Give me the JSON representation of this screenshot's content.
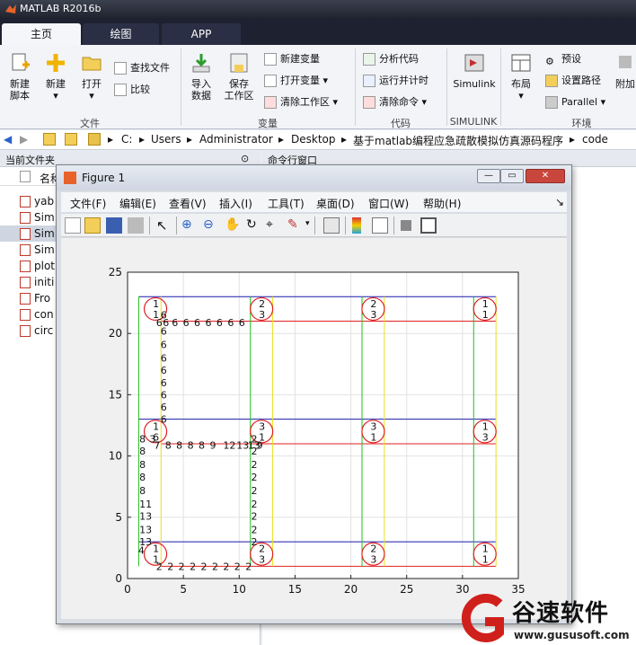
{
  "app": {
    "title": "MATLAB R2016b"
  },
  "tabs": [
    {
      "label": "主页",
      "active": true
    },
    {
      "label": "绘图",
      "active": false
    },
    {
      "label": "APP",
      "active": false
    }
  ],
  "ribbon": {
    "new_script": "新建\n脚本",
    "new": "新建",
    "open": "打开",
    "find_files": "查找文件",
    "compare": "比较",
    "import_data": "导入\n数据",
    "save_workspace": "保存\n工作区",
    "new_variable": "新建变量",
    "open_variable": "打开变量",
    "clear_workspace": "清除工作区",
    "analyze_code": "分析代码",
    "run_time": "运行并计时",
    "clear_commands": "清除命令",
    "simulink": "Simulink",
    "layout": "布局",
    "preferences": "预设",
    "set_path": "设置路径",
    "parallel": "Parallel",
    "addons": "附加",
    "groups": {
      "file": "文件",
      "variable": "变量",
      "code": "代码",
      "simulink": "SIMULINK",
      "env": "环境"
    }
  },
  "address": {
    "crumbs": [
      "C:",
      "Users",
      "Administrator",
      "Desktop",
      "基于matlab编程应急疏散模拟仿真源码程序",
      "code"
    ]
  },
  "current_folder": {
    "title": "当前文件夹",
    "name_col": "名称",
    "files": [
      "yab",
      "Sim",
      "Sim",
      "Sim",
      "plot",
      "initi",
      "Fro",
      "con",
      "circ"
    ]
  },
  "command_window": {
    "title": "命令行窗口"
  },
  "figure": {
    "title": "Figure 1",
    "menu": [
      "文件(F)",
      "编辑(E)",
      "查看(V)",
      "插入(I)",
      "工具(T)",
      "桌面(D)",
      "窗口(W)",
      "帮助(H)"
    ]
  },
  "chart_data": {
    "type": "scatter",
    "xlim": [
      0,
      35
    ],
    "ylim": [
      0,
      25
    ],
    "xticks": [
      0,
      5,
      10,
      15,
      20,
      25,
      30,
      35
    ],
    "yticks": [
      0,
      5,
      10,
      15,
      20,
      25
    ],
    "grid": true,
    "hlines": [
      {
        "y": 23,
        "x1": 1,
        "x2": 33,
        "color": "#1a1aaa"
      },
      {
        "y": 21,
        "x1": 3,
        "x2": 33,
        "color": "#e02020"
      },
      {
        "y": 13,
        "x1": 1,
        "x2": 33,
        "color": "#1a1aaa"
      },
      {
        "y": 11,
        "x1": 3,
        "x2": 33,
        "color": "#e02020"
      },
      {
        "y": 3,
        "x1": 1,
        "x2": 33,
        "color": "#1a1aaa"
      },
      {
        "y": 1,
        "x1": 3,
        "x2": 33,
        "color": "#e02020"
      }
    ],
    "vlines": [
      {
        "x": 1,
        "y1": 1,
        "y2": 23,
        "color": "#20c020"
      },
      {
        "x": 3,
        "y1": 1,
        "y2": 23,
        "color": "#e8e020"
      },
      {
        "x": 11,
        "y1": 1,
        "y2": 23,
        "color": "#20c020"
      },
      {
        "x": 13,
        "y1": 1,
        "y2": 23,
        "color": "#e8e020"
      },
      {
        "x": 21,
        "y1": 1,
        "y2": 23,
        "color": "#20c020"
      },
      {
        "x": 23,
        "y1": 1,
        "y2": 23,
        "color": "#e8e020"
      },
      {
        "x": 31,
        "y1": 1,
        "y2": 23,
        "color": "#20c020"
      },
      {
        "x": 33,
        "y1": 1,
        "y2": 23,
        "color": "#e8e020"
      }
    ],
    "circles": [
      {
        "x": 2.5,
        "y": 22,
        "top": "1",
        "bottom": "1"
      },
      {
        "x": 12,
        "y": 22,
        "top": "2",
        "bottom": "3"
      },
      {
        "x": 22,
        "y": 22,
        "top": "2",
        "bottom": "3"
      },
      {
        "x": 32,
        "y": 22,
        "top": "1",
        "bottom": "1"
      },
      {
        "x": 2.5,
        "y": 12,
        "top": "1",
        "bottom": "6"
      },
      {
        "x": 12,
        "y": 12,
        "top": "3",
        "bottom": "1"
      },
      {
        "x": 22,
        "y": 12,
        "top": "3",
        "bottom": "1"
      },
      {
        "x": 32,
        "y": 12,
        "top": "1",
        "bottom": "3"
      },
      {
        "x": 2.5,
        "y": 2,
        "top": "1",
        "bottom": "1"
      },
      {
        "x": 12,
        "y": 2,
        "top": "2",
        "bottom": "3"
      },
      {
        "x": 22,
        "y": 2,
        "top": "2",
        "bottom": "3"
      },
      {
        "x": 32,
        "y": 2,
        "top": "1",
        "bottom": "1"
      }
    ],
    "labels": [
      {
        "x": 2.8,
        "y": 20.9,
        "t": "6"
      },
      {
        "x": 3.4,
        "y": 20.9,
        "t": "6"
      },
      {
        "x": 4.2,
        "y": 20.9,
        "t": "6"
      },
      {
        "x": 5.2,
        "y": 20.9,
        "t": "6"
      },
      {
        "x": 6.2,
        "y": 20.9,
        "t": "6"
      },
      {
        "x": 7.2,
        "y": 20.9,
        "t": "6"
      },
      {
        "x": 8.2,
        "y": 20.9,
        "t": "6"
      },
      {
        "x": 9.2,
        "y": 20.9,
        "t": "6"
      },
      {
        "x": 10.2,
        "y": 20.9,
        "t": "6"
      },
      {
        "x": 3.2,
        "y": 21.5,
        "t": "6"
      },
      {
        "x": 3.2,
        "y": 20.2,
        "t": "6"
      },
      {
        "x": 3.2,
        "y": 19.1,
        "t": "6"
      },
      {
        "x": 3.2,
        "y": 18.0,
        "t": "6"
      },
      {
        "x": 3.2,
        "y": 17.0,
        "t": "6"
      },
      {
        "x": 3.2,
        "y": 16.0,
        "t": "6"
      },
      {
        "x": 3.2,
        "y": 15.0,
        "t": "6"
      },
      {
        "x": 3.2,
        "y": 14.0,
        "t": "6"
      },
      {
        "x": 3.2,
        "y": 13.0,
        "t": "6"
      },
      {
        "x": 1.3,
        "y": 11.4,
        "t": "8"
      },
      {
        "x": 2.2,
        "y": 11.4,
        "t": "3"
      },
      {
        "x": 2.6,
        "y": 10.9,
        "t": "7"
      },
      {
        "x": 3.6,
        "y": 10.9,
        "t": "8"
      },
      {
        "x": 4.6,
        "y": 10.9,
        "t": "8"
      },
      {
        "x": 5.6,
        "y": 10.9,
        "t": "8"
      },
      {
        "x": 6.6,
        "y": 10.9,
        "t": "8"
      },
      {
        "x": 7.6,
        "y": 10.9,
        "t": "9"
      },
      {
        "x": 8.8,
        "y": 10.9,
        "t": "12"
      },
      {
        "x": 10.0,
        "y": 10.9,
        "t": "13"
      },
      {
        "x": 11.0,
        "y": 10.9,
        "t": "13"
      },
      {
        "x": 11.8,
        "y": 10.9,
        "t": "9"
      },
      {
        "x": 1.3,
        "y": 10.4,
        "t": "8"
      },
      {
        "x": 1.3,
        "y": 9.3,
        "t": "8"
      },
      {
        "x": 1.3,
        "y": 8.3,
        "t": "8"
      },
      {
        "x": 1.3,
        "y": 7.2,
        "t": "8"
      },
      {
        "x": 1.3,
        "y": 6.1,
        "t": "11"
      },
      {
        "x": 1.3,
        "y": 5.1,
        "t": "13"
      },
      {
        "x": 1.3,
        "y": 4.0,
        "t": "13"
      },
      {
        "x": 1.3,
        "y": 3.0,
        "t": "13"
      },
      {
        "x": 1.2,
        "y": 2.3,
        "t": "4"
      },
      {
        "x": 11.3,
        "y": 11.4,
        "t": "2"
      },
      {
        "x": 11.3,
        "y": 10.4,
        "t": "2"
      },
      {
        "x": 11.3,
        "y": 9.3,
        "t": "2"
      },
      {
        "x": 11.3,
        "y": 8.3,
        "t": "2"
      },
      {
        "x": 11.3,
        "y": 7.2,
        "t": "2"
      },
      {
        "x": 11.3,
        "y": 6.1,
        "t": "2"
      },
      {
        "x": 11.3,
        "y": 5.1,
        "t": "2"
      },
      {
        "x": 11.3,
        "y": 4.0,
        "t": "2"
      },
      {
        "x": 11.3,
        "y": 3.0,
        "t": "2"
      },
      {
        "x": 2.8,
        "y": 1.0,
        "t": "2"
      },
      {
        "x": 3.8,
        "y": 1.0,
        "t": "2"
      },
      {
        "x": 4.8,
        "y": 1.0,
        "t": "2"
      },
      {
        "x": 5.8,
        "y": 1.0,
        "t": "2"
      },
      {
        "x": 6.8,
        "y": 1.0,
        "t": "2"
      },
      {
        "x": 7.8,
        "y": 1.0,
        "t": "2"
      },
      {
        "x": 8.8,
        "y": 1.0,
        "t": "2"
      },
      {
        "x": 9.8,
        "y": 1.0,
        "t": "2"
      },
      {
        "x": 10.8,
        "y": 1.0,
        "t": "2"
      }
    ]
  },
  "watermark": {
    "brand": "谷速软件",
    "url": "www.gususoft.com"
  }
}
